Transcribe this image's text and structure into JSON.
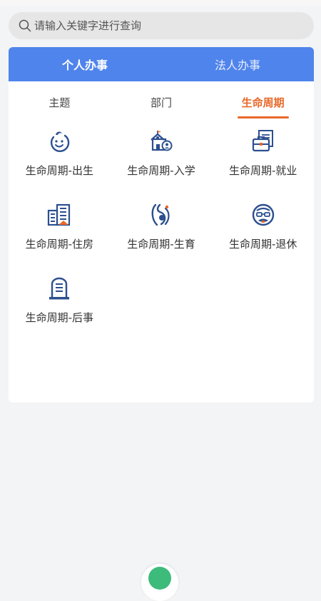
{
  "search": {
    "placeholder": "请输入关键字进行查询"
  },
  "top_tabs": [
    {
      "label": "个人办事",
      "active": true
    },
    {
      "label": "法人办事",
      "active": false
    }
  ],
  "sub_tabs": [
    {
      "label": "主题",
      "active": false
    },
    {
      "label": "部门",
      "active": false
    },
    {
      "label": "生命周期",
      "active": true
    }
  ],
  "items": [
    {
      "label": "生命周期-出生",
      "icon": "baby-face-icon"
    },
    {
      "label": "生命周期-入学",
      "icon": "school-icon"
    },
    {
      "label": "生命周期-就业",
      "icon": "briefcase-icon"
    },
    {
      "label": "生命周期-住房",
      "icon": "buildings-icon"
    },
    {
      "label": "生命周期-生育",
      "icon": "pregnancy-icon"
    },
    {
      "label": "生命周期-退休",
      "icon": "elderly-face-icon"
    },
    {
      "label": "生命周期-后事",
      "icon": "tombstone-icon"
    }
  ],
  "colors": {
    "primary": "#4f84ec",
    "accent": "#e8692a",
    "icon": "#2c4f8f"
  }
}
